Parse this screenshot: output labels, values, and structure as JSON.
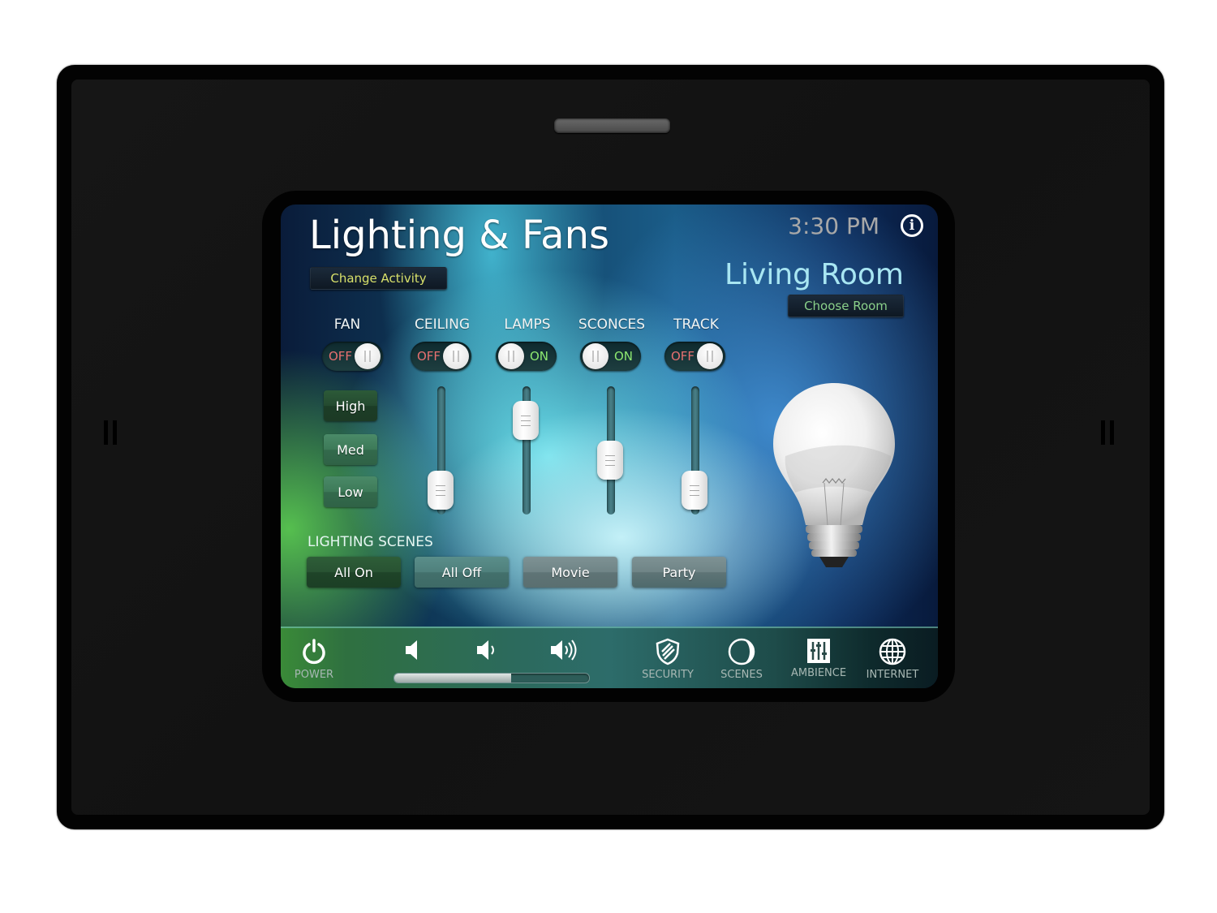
{
  "header": {
    "title": "Lighting & Fans",
    "change_activity_label": "Change Activity",
    "time": "3:30 PM",
    "info_icon": "info-icon",
    "room": "Living Room",
    "choose_room_label": "Choose Room"
  },
  "devices": [
    {
      "label": "FAN",
      "state": "OFF",
      "on": false
    },
    {
      "label": "CEILING",
      "state": "OFF",
      "on": false,
      "level_percent": 10
    },
    {
      "label": "LAMPS",
      "state": "ON",
      "on": true,
      "level_percent": 80
    },
    {
      "label": "SCONCES",
      "state": "ON",
      "on": true,
      "level_percent": 40
    },
    {
      "label": "TRACK",
      "state": "OFF",
      "on": false,
      "level_percent": 10
    }
  ],
  "fan_speeds": [
    {
      "label": "High",
      "active": true
    },
    {
      "label": "Med",
      "active": false
    },
    {
      "label": "Low",
      "active": false
    }
  ],
  "scenes": {
    "heading": "LIGHTING SCENES",
    "buttons": [
      {
        "label": "All On"
      },
      {
        "label": "All Off"
      },
      {
        "label": "Movie"
      },
      {
        "label": "Party"
      }
    ]
  },
  "bottom_bar": {
    "power_label": "POWER",
    "volume_percent": 60,
    "volume_icons": [
      "volume-mute-icon",
      "volume-low-icon",
      "volume-high-icon"
    ],
    "nav": [
      {
        "label": "SECURITY",
        "icon": "shield-icon"
      },
      {
        "label": "SCENES",
        "icon": "moon-icon"
      },
      {
        "label": "AMBIENCE",
        "icon": "equalizer-icon"
      },
      {
        "label": "INTERNET",
        "icon": "globe-icon"
      }
    ]
  },
  "colors": {
    "off_state": "#e67070",
    "on_state": "#8de870",
    "change_activity_text": "#d8e06a",
    "choose_room_text": "#8ad08a",
    "room_text": "#a8e6f2",
    "time_text": "#a8a8a8"
  }
}
